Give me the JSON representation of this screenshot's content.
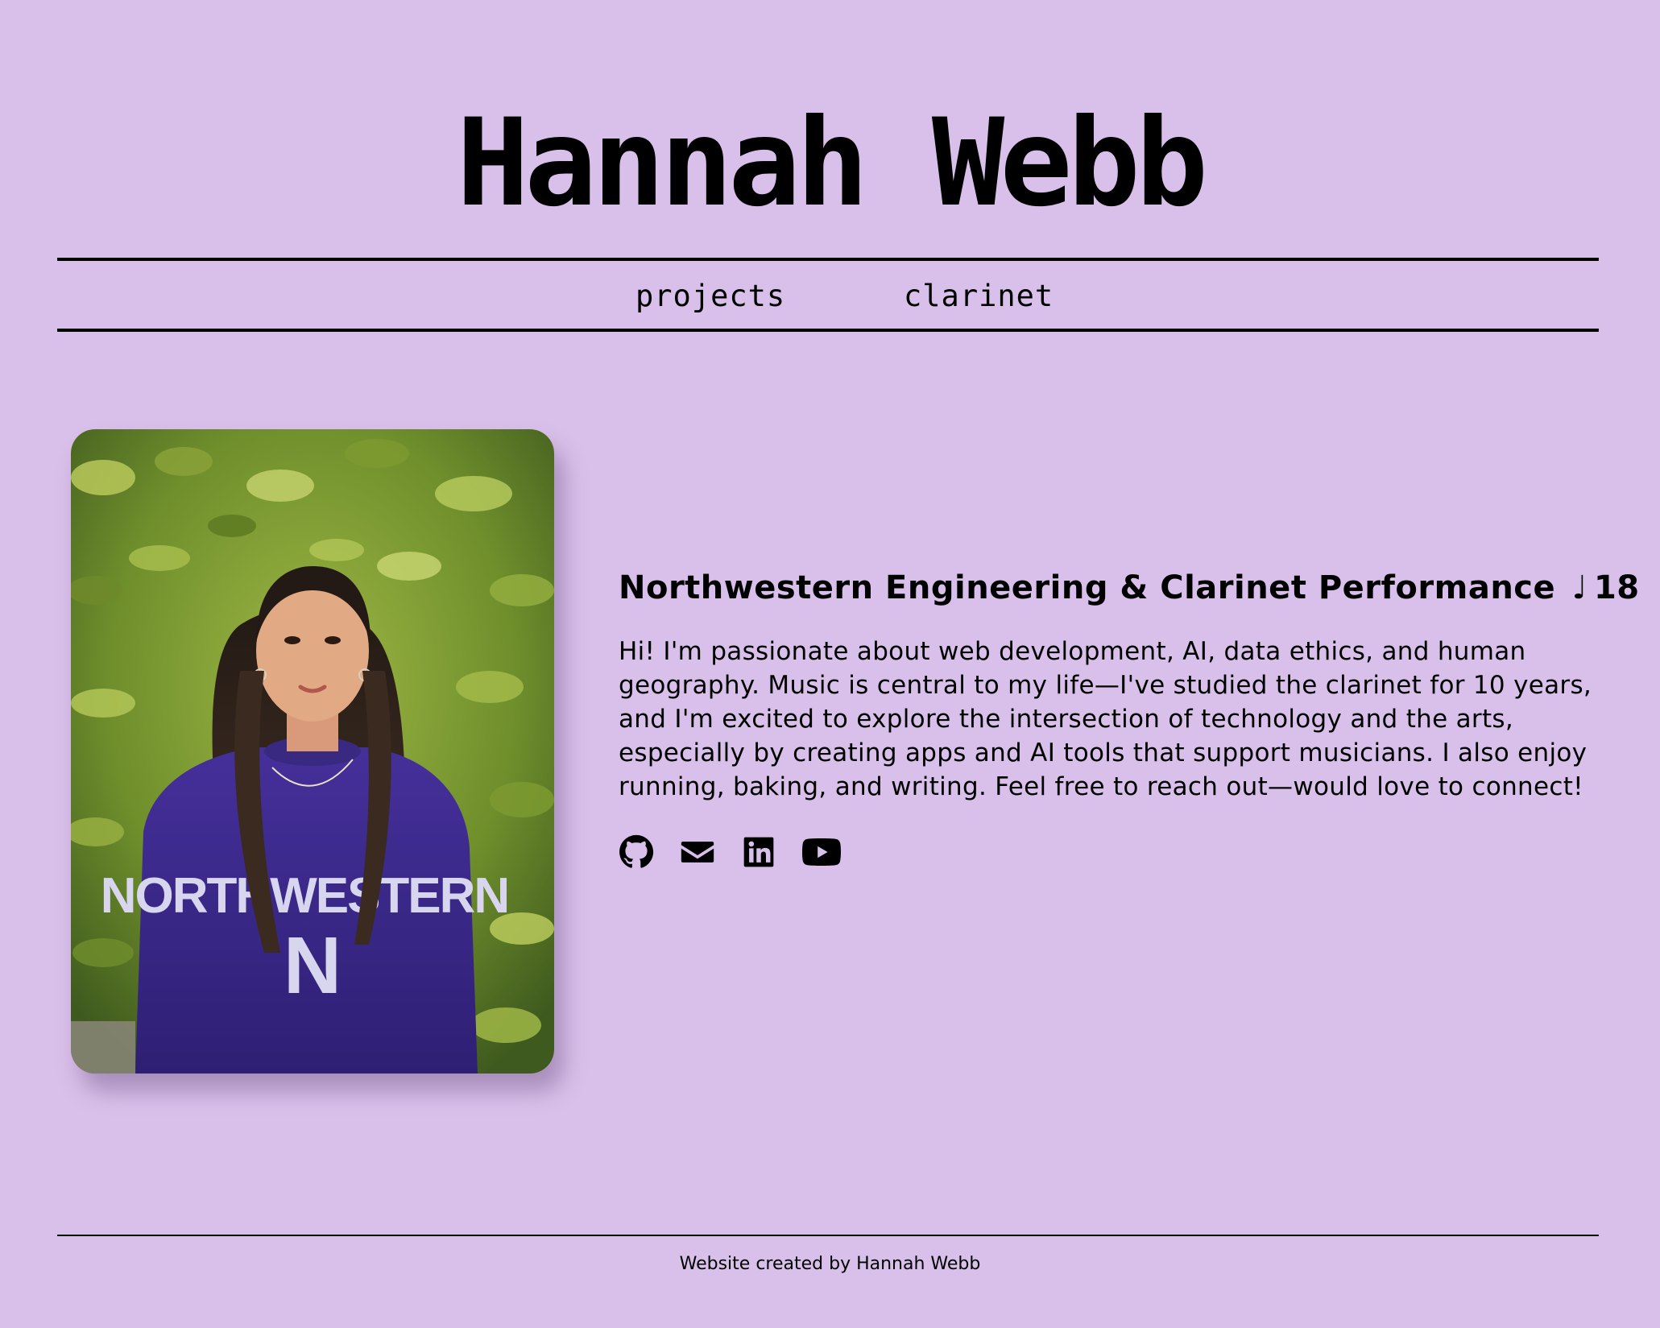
{
  "header": {
    "title": "Hannah Webb"
  },
  "nav": {
    "items": [
      {
        "label": "projects"
      },
      {
        "label": "clarinet"
      }
    ]
  },
  "profile": {
    "photo": "portrait photo of Hannah Webb",
    "subtitle_main": "Northwestern Engineering & Clarinet Performance",
    "subtitle_note": "♩",
    "subtitle_year": "18",
    "bio": "Hi! I'm passionate about web development, AI, data ethics, and human geography. Music is central to my life—I've studied the clarinet for 10 years, and I'm excited to explore the intersection of technology and the arts, especially by creating apps and AI tools that support musicians. I also enjoy running, baking, and writing. Feel free to reach out—would love to connect!"
  },
  "social": {
    "icons": [
      "github-icon",
      "email-icon",
      "linkedin-icon",
      "youtube-icon"
    ]
  },
  "footer": {
    "text": "Website created by Hannah Webb"
  },
  "colors": {
    "background": "#d9c0ea",
    "text": "#000000",
    "sweatshirt": "#3d2a86"
  }
}
